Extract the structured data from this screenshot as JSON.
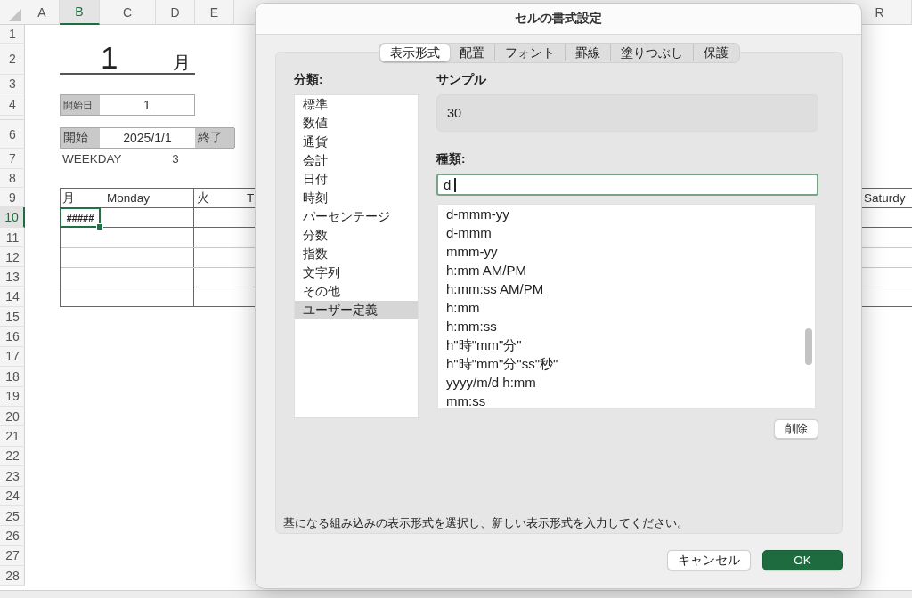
{
  "sheet": {
    "column_headers": [
      {
        "label": "A",
        "selected": false
      },
      {
        "label": "B",
        "selected": true
      },
      {
        "label": "C",
        "selected": false
      },
      {
        "label": "D",
        "selected": false
      },
      {
        "label": "E",
        "selected": false
      },
      {
        "label": "R",
        "selected": false
      }
    ],
    "row_headers": [
      {
        "kind": "normal",
        "label": "1",
        "selected": false
      },
      {
        "kind": "normal",
        "label": "2",
        "selected": false
      },
      {
        "kind": "normal",
        "label": "3",
        "selected": false
      },
      {
        "kind": "normal",
        "label": "4",
        "selected": false
      },
      {
        "kind": "squeezed",
        "selected": false
      },
      {
        "kind": "normal",
        "label": "6",
        "selected": false
      },
      {
        "kind": "normal",
        "label": "7",
        "selected": false
      },
      {
        "kind": "normal",
        "label": "8",
        "selected": false
      },
      {
        "kind": "normal",
        "label": "9",
        "selected": false
      },
      {
        "kind": "normal",
        "label": "10",
        "selected": true
      },
      {
        "kind": "normal",
        "label": "11",
        "selected": false
      },
      {
        "kind": "normal",
        "label": "12",
        "selected": false
      },
      {
        "kind": "normal",
        "label": "13",
        "selected": false
      },
      {
        "kind": "normal",
        "label": "14",
        "selected": false
      },
      {
        "kind": "normal",
        "label": "15",
        "selected": false
      },
      {
        "kind": "normal",
        "label": "16",
        "selected": false
      },
      {
        "kind": "normal",
        "label": "17",
        "selected": false
      },
      {
        "kind": "normal",
        "label": "18",
        "selected": false
      },
      {
        "kind": "normal",
        "label": "19",
        "selected": false
      },
      {
        "kind": "normal",
        "label": "20",
        "selected": false
      },
      {
        "kind": "normal",
        "label": "21",
        "selected": false
      },
      {
        "kind": "normal",
        "label": "22",
        "selected": false
      },
      {
        "kind": "normal",
        "label": "23",
        "selected": false
      },
      {
        "kind": "normal",
        "label": "24",
        "selected": false
      },
      {
        "kind": "normal",
        "label": "25",
        "selected": false
      },
      {
        "kind": "normal",
        "label": "26",
        "selected": false
      },
      {
        "kind": "normal",
        "label": "27",
        "selected": false
      },
      {
        "kind": "normal",
        "label": "28",
        "selected": false
      }
    ],
    "month": {
      "number": "1",
      "unit": "月"
    },
    "start_day": {
      "label": "開始日",
      "value": "1"
    },
    "period": {
      "start_label": "開始",
      "start_value": "2025/1/1",
      "end_label": "終了"
    },
    "weekday": {
      "label": "WEEKDAY",
      "value": "3"
    },
    "calendar": {
      "headers": [
        "月",
        "Monday",
        "火",
        "T",
        "Saturdy"
      ],
      "active_cell": "#####"
    }
  },
  "dialog": {
    "title": "セルの書式設定",
    "tabs": [
      {
        "label": "表示形式",
        "selected": true
      },
      {
        "label": "配置",
        "selected": false
      },
      {
        "label": "フォント",
        "selected": false
      },
      {
        "label": "罫線",
        "selected": false
      },
      {
        "label": "塗りつぶし",
        "selected": false
      },
      {
        "label": "保護",
        "selected": false
      }
    ],
    "category_label": "分類:",
    "categories": [
      {
        "label": "標準",
        "selected": false
      },
      {
        "label": "数値",
        "selected": false
      },
      {
        "label": "通貨",
        "selected": false
      },
      {
        "label": "会計",
        "selected": false
      },
      {
        "label": "日付",
        "selected": false
      },
      {
        "label": "時刻",
        "selected": false
      },
      {
        "label": "パーセンテージ",
        "selected": false
      },
      {
        "label": "分数",
        "selected": false
      },
      {
        "label": "指数",
        "selected": false
      },
      {
        "label": "文字列",
        "selected": false
      },
      {
        "label": "その他",
        "selected": false
      },
      {
        "label": "ユーザー定義",
        "selected": true
      }
    ],
    "sample_label": "サンプル",
    "sample_value": "30",
    "type_label": "種類:",
    "type_input": {
      "value": "d"
    },
    "formats": [
      {
        "label": "d-mmm-yy",
        "selected": false
      },
      {
        "label": "d-mmm",
        "selected": false
      },
      {
        "label": "mmm-yy",
        "selected": false
      },
      {
        "label": "h:mm AM/PM",
        "selected": false
      },
      {
        "label": "h:mm:ss AM/PM",
        "selected": false
      },
      {
        "label": "h:mm",
        "selected": false
      },
      {
        "label": "h:mm:ss",
        "selected": false
      },
      {
        "label": "h\"時\"mm\"分\"",
        "selected": false
      },
      {
        "label": "h\"時\"mm\"分\"ss\"秒\"",
        "selected": false
      },
      {
        "label": "yyyy/m/d h:mm",
        "selected": false
      },
      {
        "label": "mm:ss",
        "selected": false
      }
    ],
    "delete_button": "削除",
    "hint": "基になる組み込みの表示形式を選択し、新しい表示形式を入力してください。",
    "buttons": [
      {
        "label": "キャンセル",
        "kind": "secondary"
      },
      {
        "label": "OK",
        "kind": "primary"
      }
    ]
  }
}
